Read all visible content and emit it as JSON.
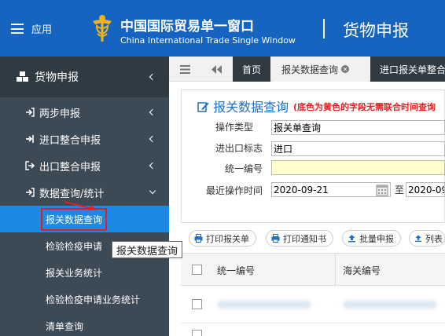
{
  "header": {
    "menu_label": "应用",
    "brand_cn": "中国国际贸易单一窗口",
    "brand_en": "China International Trade Single Window",
    "page_name": "货物申报",
    "colors": {
      "header_bg": "#1565c0",
      "logo_gold": "#f2b21b"
    }
  },
  "sidebar": {
    "section": {
      "label": "货物申报",
      "icon": "cubes-icon"
    },
    "items": [
      {
        "label": "两步申报",
        "icon": "sign-in-icon"
      },
      {
        "label": "进口整合申报",
        "icon": "import-icon"
      },
      {
        "label": "出口整合申报",
        "icon": "export-icon"
      },
      {
        "label": "数据查询/统计",
        "icon": "sign-in-icon"
      }
    ],
    "subitems": [
      {
        "label": "报关数据查询",
        "active": true
      },
      {
        "label": "检验检疫申请"
      },
      {
        "label": "报关业务统计"
      },
      {
        "label": "检验检疫申请业务统计"
      },
      {
        "label": "清单查询"
      }
    ],
    "colors": {
      "bg": "#3c4a56",
      "active_bg": "#1e88e5",
      "highlight": "#e02020"
    }
  },
  "tabs": {
    "items": [
      {
        "label": "首页"
      },
      {
        "label": "报关数据查询",
        "closable": true
      },
      {
        "label": "进口报关单整合"
      }
    ]
  },
  "form": {
    "title": "报关数据查询",
    "note": "(底色为黄色的字段无需联合时间查询",
    "fields": [
      {
        "label": "操作类型",
        "value": "报关单查询"
      },
      {
        "label": "进出口标志",
        "value": "进口"
      },
      {
        "label": "统一编号",
        "value": ""
      },
      {
        "label": "最近操作时间",
        "value": "2020-09-21",
        "to_label": "至",
        "to_value": "2020-09"
      }
    ]
  },
  "toolbar": {
    "buttons": [
      {
        "label": "打印报关单",
        "icon": "print-icon"
      },
      {
        "label": "打印通知书",
        "icon": "print-icon"
      },
      {
        "label": "批量申报",
        "icon": "upload-icon"
      },
      {
        "label": "列表",
        "icon": "upload-icon"
      }
    ]
  },
  "table": {
    "columns": [
      "统一编号",
      "海关编号"
    ]
  },
  "tooltip": {
    "text": "报关数据查询"
  }
}
